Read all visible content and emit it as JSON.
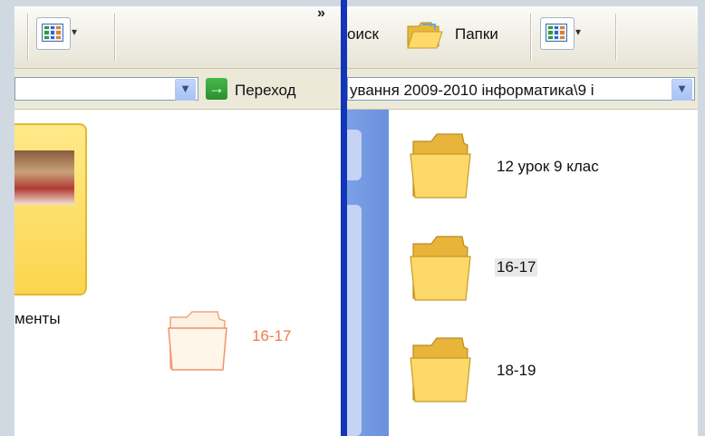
{
  "left_window": {
    "toolbar": {
      "more_chevron": "»"
    },
    "address": {
      "go_label": "Переход"
    },
    "file_caption": "менты",
    "drag_ghost_label": "16-17"
  },
  "right_window": {
    "toolbar": {
      "search_label": "оиск",
      "folders_label": "Папки"
    },
    "address": {
      "path": "ування 2009-2010 інформатика\\9 і"
    },
    "folders": [
      {
        "name": "12 урок 9 клас"
      },
      {
        "name": "16-17",
        "selected": true
      },
      {
        "name": "18-19"
      }
    ]
  },
  "colors": {
    "divider": "#1335b8",
    "folder_fill": "#fbd54d",
    "ghost": "#ee7b4a"
  }
}
